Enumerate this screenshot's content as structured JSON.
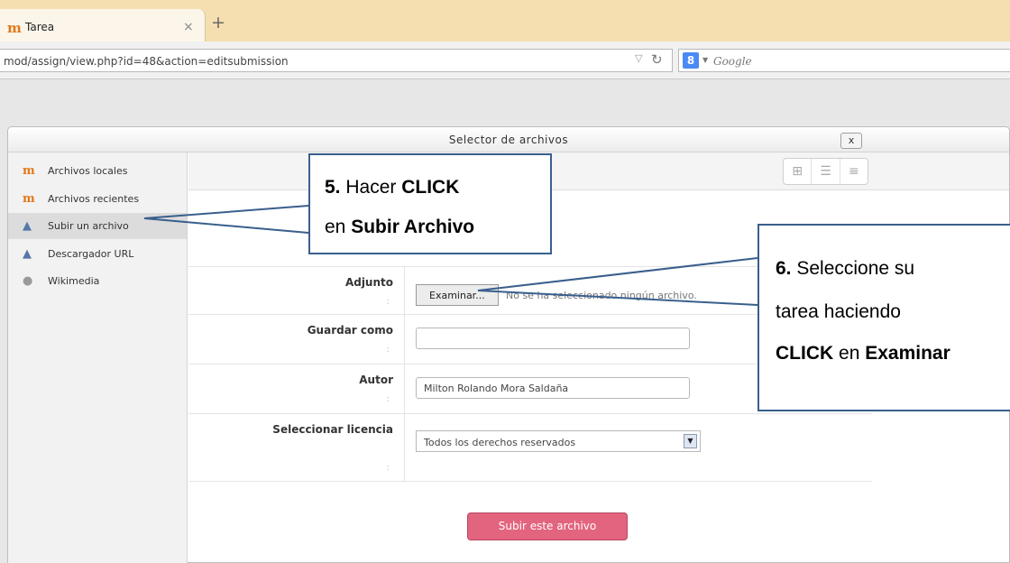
{
  "browser": {
    "tab_title": "Tarea",
    "tab_close": "×",
    "new_tab": "+",
    "url": "mod/assign/view.php?id=48&action=editsubmission",
    "reload_icon": "↻",
    "search_engine_icon": "8",
    "search_placeholder": "Google"
  },
  "dialog": {
    "title": "Selector de archivos",
    "close_label": "x",
    "sidebar": {
      "items": [
        {
          "label": "Archivos locales",
          "icon": "moodle-icon"
        },
        {
          "label": "Archivos recientes",
          "icon": "moodle-icon"
        },
        {
          "label": "Subir un archivo",
          "icon": "upload-icon",
          "selected": true
        },
        {
          "label": "Descargador URL",
          "icon": "download-icon"
        },
        {
          "label": "Wikimedia",
          "icon": "wikimedia-icon"
        }
      ]
    },
    "form": {
      "attachment_label": "Adjunto",
      "browse_button": "Examinar...",
      "no_file_text": "No se ha seleccionado ningún archivo.",
      "save_as_label": "Guardar como",
      "save_as_value": "",
      "author_label": "Autor",
      "author_value": "Milton Rolando Mora Saldaña",
      "license_label": "Seleccionar licencia",
      "license_value": "Todos los derechos reservados",
      "colon": ":",
      "upload_button": "Subir este archivo"
    }
  },
  "callouts": {
    "step5": {
      "num": "5.",
      "line1_text": "Hacer",
      "line1_bold": "CLICK",
      "line2_text": "en",
      "line2_bold": "Subir Archivo"
    },
    "step6": {
      "num": "6.",
      "line1_text": "Seleccione su",
      "line2_text": "tarea  haciendo",
      "line3_bold1": "CLICK",
      "line3_text": "en",
      "line3_bold2": "Examinar"
    }
  },
  "colors": {
    "tab_strip": "#f5deb0",
    "callout_border": "#3a5f8d",
    "upload_button": "#e3647e",
    "moodle_orange": "#e2781a"
  }
}
